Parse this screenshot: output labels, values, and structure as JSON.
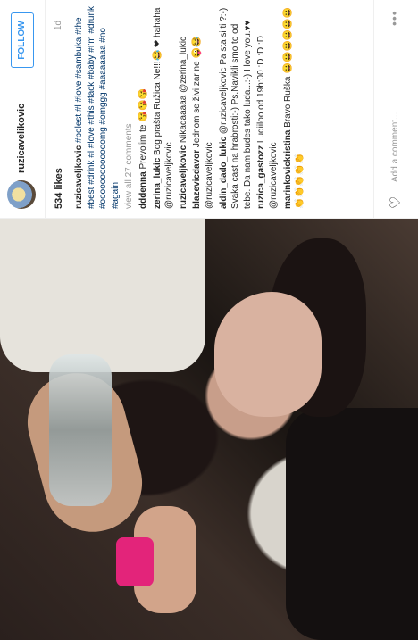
{
  "post": {
    "username": "ruzicavelikovic",
    "follow_label": "FOLLOW",
    "likes": "534 likes",
    "time": "1d",
    "add_comment_placeholder": "Add a comment...",
    "more_label": "•••"
  },
  "comments": [
    {
      "user": "ruzicaveljkovic",
      "text": "#bolest #l #love #sambuka #the #best #drink #l #love #this #fack #baby #I'm #drunk #ooooooooooooomg #omggg #aaaaaaaa #no #again"
    },
    {
      "user": "",
      "text": "view all 27 comments"
    },
    {
      "user": "dddenna",
      "text": "Prevolim te 😘😘😘"
    },
    {
      "user": "zerina_lukic",
      "text": "Bog prašta Ružica Ne!!!😂 ❤ hahaha @ruzicaveljkovic"
    },
    {
      "user": "ruzicaveljkovic",
      "text": "Nikadaaaaa @zerina_lukic"
    },
    {
      "user": "blazevicdavor",
      "text": "Jednom se živi zar ne 😜😂 @ruzicaveljkovic"
    },
    {
      "user": "aldin_dado_lukic",
      "text": "@ruzicaveljkovic Pa sta si ti ?:-) Svaka cast na hrabrosti:-) Ps.Navikli smo to od tebe. Da nam budes tako luda...:-) I love you.♥♥"
    },
    {
      "user": "ruzica_gastozz",
      "text": "Ludiiloo od 19h:00 :D :D :D @ruzicaveljkovic"
    },
    {
      "user": "marinkovickristina",
      "text": "Bravo Ruška 😀😀😀😀😀😀 👏👏👏👏👏"
    }
  ],
  "colors": {
    "link": "#003569",
    "follow": "#3897f0"
  },
  "icons": {
    "heart": "heart-icon",
    "more": "more-options-icon"
  }
}
